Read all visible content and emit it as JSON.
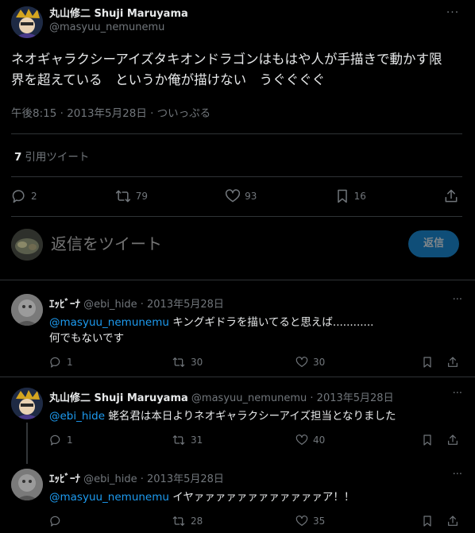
{
  "main_tweet": {
    "author_name": "丸山修二 Shuji Maruyama",
    "author_handle": "@masyuu_nemunemu",
    "more_label": "···",
    "text_line1": "ネオギャラクシーアイズタキオンドラゴンはもはや人が手描きで動かす限",
    "text_line2": "界を超えている　というか俺が描けない　うぐぐぐぐ",
    "meta": "午後8:15 · 2013年5月28日 · ついっぷる",
    "quote_count": "7",
    "quote_label": "引用ツイート",
    "actions": {
      "replies": "2",
      "retweets": "79",
      "likes": "93",
      "bookmarks": "16"
    }
  },
  "composer": {
    "placeholder": "返信をツイート",
    "button_label": "返信"
  },
  "replies": [
    {
      "name": "ｴｯﾋﾞｰﾅ",
      "handle_date": "@ebi_hide · 2013年5月28日",
      "mention": "@masyuu_nemunemu",
      "text": " キングギドラを描いてると思えば............",
      "text2": "何でもないです",
      "replies": "1",
      "retweets": "30",
      "likes": "30"
    },
    {
      "name": "丸山修二 Shuji Maruyama",
      "handle_date": "@masyuu_nemunemu · 2013年5月28日",
      "mention": "@ebi_hide",
      "text": " 蛯名君は本日よりネオギャラクシーアイズ担当となりました",
      "text2": "",
      "replies": "1",
      "retweets": "31",
      "likes": "40"
    },
    {
      "name": "ｴｯﾋﾞｰﾅ",
      "handle_date": "@ebi_hide · 2013年5月28日",
      "mention": "@masyuu_nemunemu",
      "text": " イヤァァァァァァァァァァァァア！！",
      "text2": "",
      "replies": "",
      "retweets": "28",
      "likes": "35"
    }
  ],
  "colors": {
    "background": "#000000",
    "text": "#e7e9ea",
    "secondary": "#71767b",
    "link": "#1d9bf0",
    "divider": "#2f3336",
    "reply_button": "#0f4e78"
  },
  "icons": [
    "reply-icon",
    "retweet-icon",
    "like-icon",
    "bookmark-icon",
    "share-icon",
    "more-icon"
  ]
}
